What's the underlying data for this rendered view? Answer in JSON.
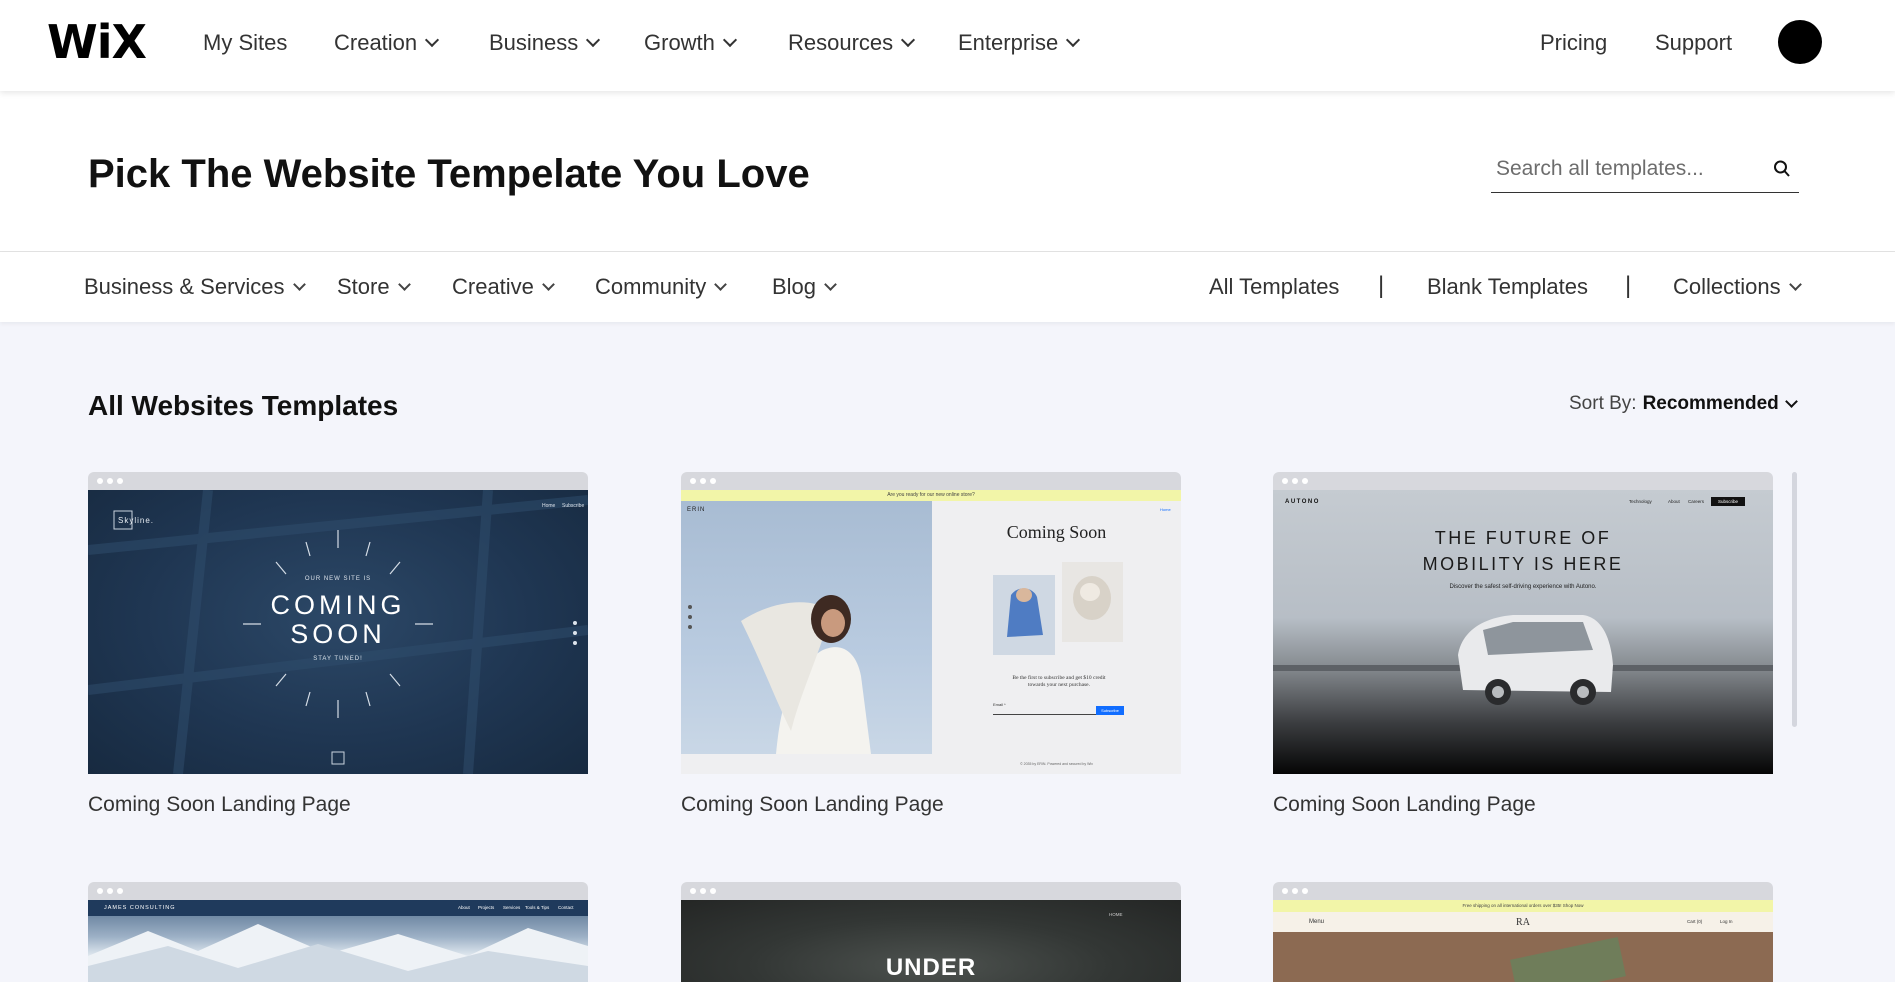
{
  "nav": {
    "logo": "WiX",
    "items": [
      {
        "label": "My Sites",
        "dropdown": false
      },
      {
        "label": "Creation",
        "dropdown": true
      },
      {
        "label": "Business",
        "dropdown": true
      },
      {
        "label": "Growth",
        "dropdown": true
      },
      {
        "label": "Resources",
        "dropdown": true
      },
      {
        "label": "Enterprise",
        "dropdown": true
      }
    ],
    "right": [
      "Pricing",
      "Support"
    ]
  },
  "header": {
    "title": "Pick The Website Tempelate You Love",
    "search_placeholder": "Search all templates..."
  },
  "categories": {
    "left": [
      "Business & Services",
      "Store",
      "Creative",
      "Community",
      "Blog"
    ],
    "right": [
      "All Templates",
      "|",
      "Blank Templates",
      "|",
      "Collections"
    ]
  },
  "section": {
    "title": "All Websites Templates",
    "sort_label": "Sort By:",
    "sort_value": "Recommended"
  },
  "cards": [
    {
      "label": "Coming Soon Landing Page",
      "preview": {
        "brand": "Skyline.",
        "nav": [
          "Home",
          "Subscribe"
        ],
        "kicker": "OUR NEW SITE IS",
        "headline_1": "COMING",
        "headline_2": "SOON",
        "sub": "STAY TUNED!"
      }
    },
    {
      "label": "Coming Soon Landing Page",
      "preview": {
        "banner": "Are you ready for our new online store?",
        "brand": "ERIN",
        "nav": "Home",
        "headline": "Coming Soon",
        "blurb": "Be the first to subscribe and get $10 credit towards your next purchase.",
        "email_label": "Email *",
        "button": "Subscribe",
        "footer": "© 2035 by ERIN. Powered and secured by Wix"
      }
    },
    {
      "label": "Coming Soon Landing Page",
      "preview": {
        "brand": "AUTONO",
        "nav": [
          "Technology",
          "About",
          "Careers"
        ],
        "nav_button": "Subscribe",
        "headline_1": "THE FUTURE OF",
        "headline_2": "MOBILITY IS HERE",
        "sub": "Discover the safest self-driving experience with Autono."
      }
    },
    {
      "preview": {
        "brand": "JAMES CONSULTING",
        "nav": [
          "About",
          "Projects",
          "Services",
          "Tools & Tips",
          "Contact"
        ]
      }
    },
    {
      "preview": {
        "nav": "HOME",
        "headline": "UNDER"
      }
    },
    {
      "preview": {
        "banner": "Free shipping on all international orders over $35! Shop Now",
        "menu": "Menu",
        "brand": "RA",
        "cart": "Cart (0)",
        "login": "Log In"
      }
    }
  ],
  "colors": {
    "accent_dark": "#1e3550",
    "yellow_banner": "#f2f5a8",
    "wix_blue": "#116dff"
  }
}
